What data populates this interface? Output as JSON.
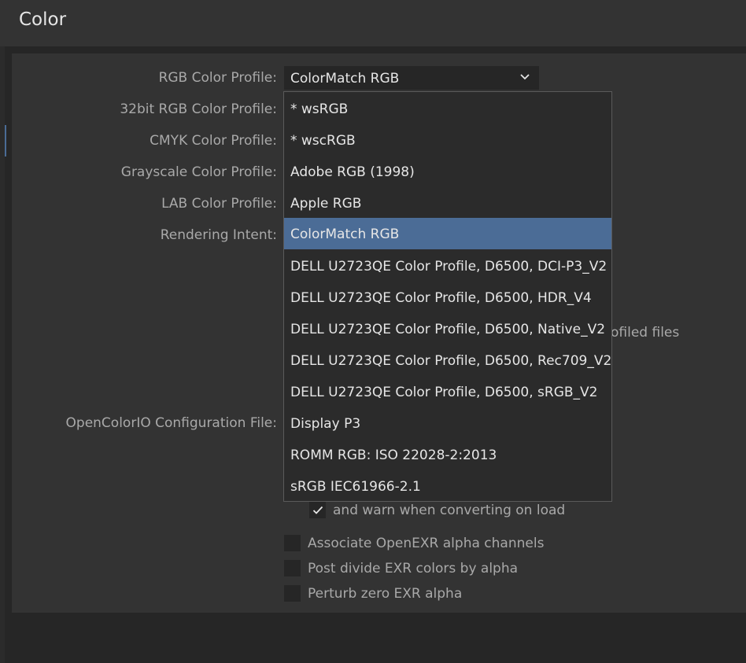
{
  "header": {
    "title": "Color"
  },
  "labels": {
    "rgb": "RGB Color Profile:",
    "rgb32": "32bit RGB Color Profile:",
    "cmyk": "CMYK Color Profile:",
    "gray": "Grayscale Color Profile:",
    "lab": "LAB Color Profile:",
    "intent": "Rendering Intent:",
    "ocio": "OpenColorIO Configuration File:"
  },
  "rgb_combo": {
    "value": "ColorMatch RGB",
    "icon": "chevron-down-icon"
  },
  "dropdown": {
    "options": [
      "* wsRGB",
      "* wscRGB",
      "Adobe RGB (1998)",
      "Apple RGB",
      "ColorMatch RGB",
      "DELL U2723QE Color Profile, D6500, DCI-P3_V2",
      "DELL U2723QE Color Profile, D6500, HDR_V4",
      "DELL U2723QE Color Profile, D6500, Native_V2",
      "DELL U2723QE Color Profile, D6500, Rec709_V2",
      "DELL U2723QE Color Profile, D6500, sRGB_V2",
      "Display P3",
      "ROMM RGB: ISO 22028-2:2013",
      "sRGB IEC61966-2.1"
    ],
    "selected": "ColorMatch RGB"
  },
  "partial_text": "ofiled files",
  "checkboxes": {
    "warn": {
      "label": "and warn when converting on load",
      "checked": true
    },
    "assoc": {
      "label": "Associate OpenEXR alpha channels",
      "checked": false
    },
    "postdiv": {
      "label": "Post divide EXR colors by alpha",
      "checked": false
    },
    "perturb": {
      "label": "Perturb zero EXR alpha",
      "checked": false
    }
  },
  "colors": {
    "accent": "#4b6c96",
    "panel": "#333333",
    "field": "#262626"
  }
}
